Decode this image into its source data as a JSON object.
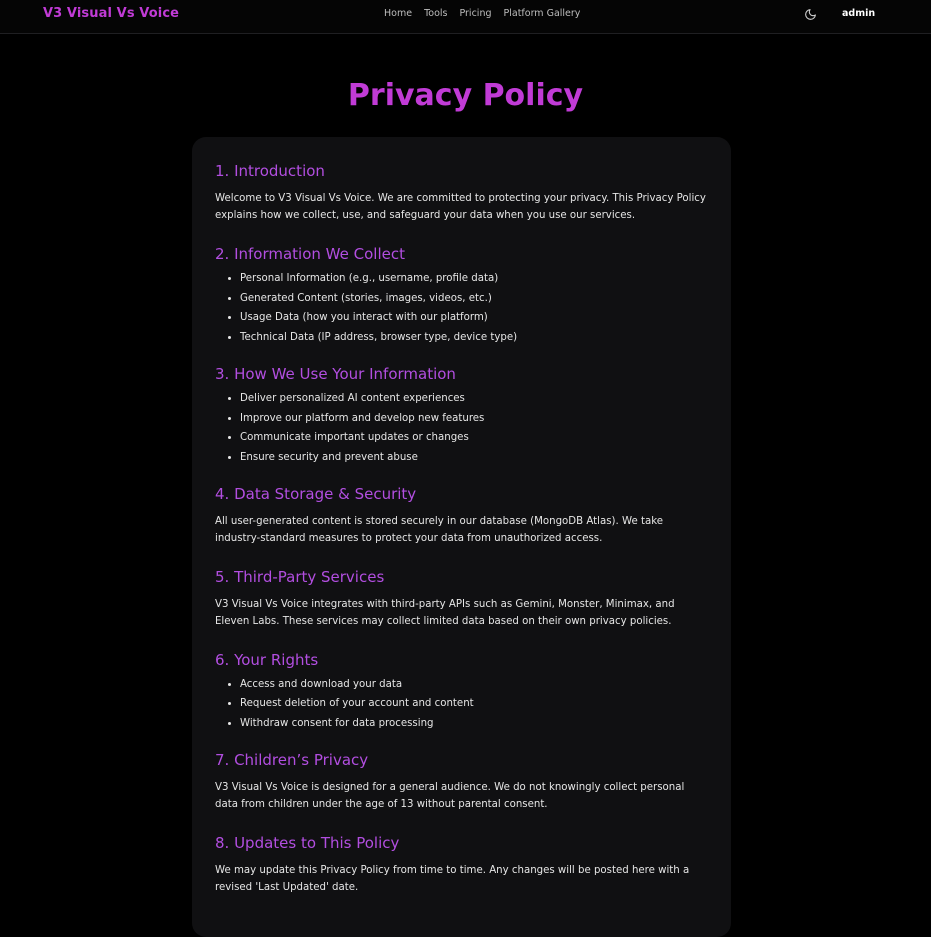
{
  "header": {
    "brand": "V3 Visual Vs Voice",
    "nav": [
      "Home",
      "Tools",
      "Pricing",
      "Platform Gallery"
    ],
    "theme_icon": "moon-icon",
    "user": "admin"
  },
  "page": {
    "title": "Privacy Policy"
  },
  "sections": [
    {
      "heading": "1. Introduction",
      "text": "Welcome to V3 Visual Vs Voice. We are committed to protecting your privacy. This Privacy Policy explains how we collect, use, and safeguard your data when you use our services."
    },
    {
      "heading": "2. Information We Collect",
      "items": [
        "Personal Information (e.g., username, profile data)",
        "Generated Content (stories, images, videos, etc.)",
        "Usage Data (how you interact with our platform)",
        "Technical Data (IP address, browser type, device type)"
      ]
    },
    {
      "heading": "3. How We Use Your Information",
      "items": [
        "Deliver personalized AI content experiences",
        "Improve our platform and develop new features",
        "Communicate important updates or changes",
        "Ensure security and prevent abuse"
      ]
    },
    {
      "heading": "4. Data Storage & Security",
      "text": "All user-generated content is stored securely in our database (MongoDB Atlas). We take industry-standard measures to protect your data from unauthorized access."
    },
    {
      "heading": "5. Third-Party Services",
      "text": "V3 Visual Vs Voice integrates with third-party APIs such as Gemini, Monster, Minimax, and Eleven Labs. These services may collect limited data based on their own privacy policies."
    },
    {
      "heading": "6. Your Rights",
      "items": [
        "Access and download your data",
        "Request deletion of your account and content",
        "Withdraw consent for data processing"
      ]
    },
    {
      "heading": "7. Children’s Privacy",
      "text": "V3 Visual Vs Voice is designed for a general audience. We do not knowingly collect personal data from children under the age of 13 without parental consent."
    },
    {
      "heading": "8. Updates to This Policy",
      "text": "We may update this Privacy Policy from time to time. Any changes will be posted here with a revised 'Last Updated' date."
    }
  ],
  "colors": {
    "accent": "#c13bd6",
    "heading": "#b24ee0",
    "background": "#000000",
    "card": "#101012"
  }
}
